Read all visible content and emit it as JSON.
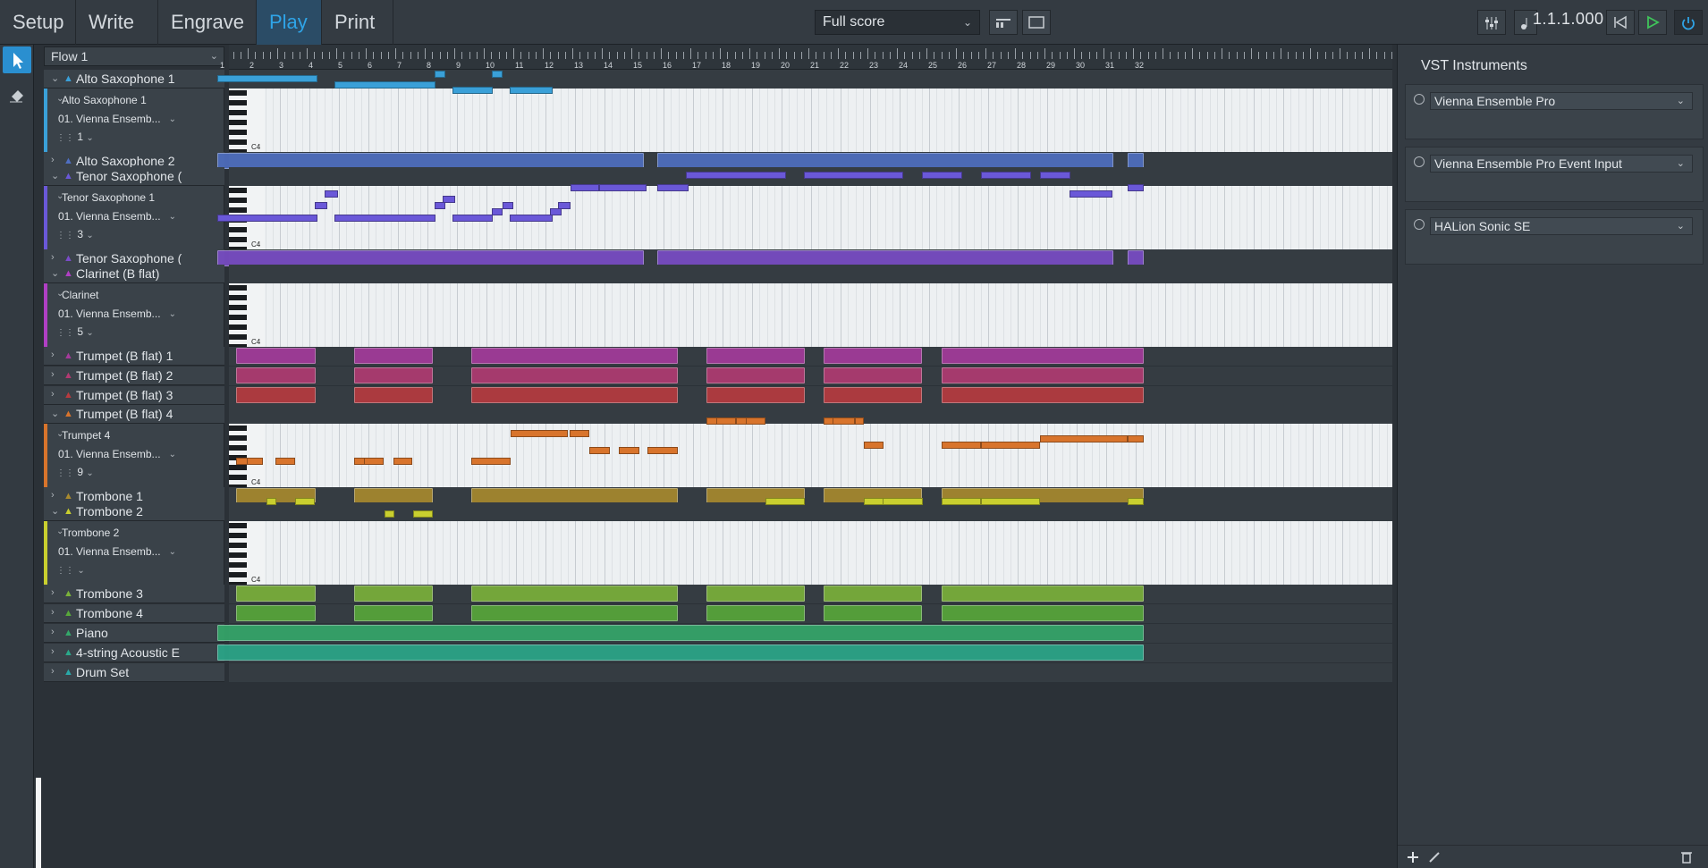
{
  "modes": [
    "Setup",
    "Write",
    "Engrave",
    "Play",
    "Print"
  ],
  "active_mode": "Play",
  "score_select": {
    "value": "Full score"
  },
  "position_readout": "1.1.1.000",
  "flow_select": {
    "value": "Flow 1"
  },
  "ruler_bars": [
    "1",
    "2",
    "3",
    "4",
    "5",
    "6",
    "7",
    "8",
    "9",
    "10",
    "11",
    "12",
    "13",
    "14",
    "15",
    "16",
    "17",
    "18",
    "19",
    "20",
    "21",
    "22",
    "23",
    "24",
    "25",
    "26",
    "27",
    "28",
    "29",
    "30",
    "31",
    "32"
  ],
  "pitch_label": "C4",
  "tracks": [
    {
      "name": "Alto Saxophone 1",
      "color": "#3aa0d8",
      "expanded": true,
      "sub": "Alto Saxophone 1",
      "port": "01. Vienna Ensemb...",
      "channel": "1"
    },
    {
      "name": "Alto Saxophone 2",
      "color": "#4f6fc2",
      "expanded": false
    },
    {
      "name": "Tenor Saxophone (",
      "color": "#6a58d8",
      "expanded": true,
      "sub": "Tenor Saxophone 1",
      "port": "01. Vienna Ensemb...",
      "channel": "3"
    },
    {
      "name": "Tenor Saxophone (",
      "color": "#7a4cc8",
      "expanded": false
    },
    {
      "name": "Clarinet (B flat)",
      "color": "#b03fc4",
      "expanded": true,
      "sub": "Clarinet",
      "port": "01. Vienna Ensemb...",
      "channel": "5"
    },
    {
      "name": "Trumpet (B flat) 1",
      "color": "#a53a9c",
      "expanded": false
    },
    {
      "name": "Trumpet (B flat) 2",
      "color": "#b23a72",
      "expanded": false
    },
    {
      "name": "Trumpet (B flat) 3",
      "color": "#b83a3f",
      "expanded": false
    },
    {
      "name": "Trumpet (B flat) 4",
      "color": "#d8742c",
      "expanded": true,
      "sub": "Trumpet 4",
      "port": "01. Vienna Ensemb...",
      "channel": "9"
    },
    {
      "name": "Trombone 1",
      "color": "#a98a2e",
      "expanded": false
    },
    {
      "name": "Trombone 2",
      "color": "#c9cf2f",
      "expanded": true,
      "sub": "Trombone 2",
      "port": "01. Vienna Ensemb...",
      "channel": ""
    },
    {
      "name": "Trombone 3",
      "color": "#7bb23a",
      "expanded": false
    },
    {
      "name": "Trombone 4",
      "color": "#58a83a",
      "expanded": false
    },
    {
      "name": "Piano",
      "color": "#34a86a",
      "expanded": false
    },
    {
      "name": "4-string Acoustic E",
      "color": "#2aa88a",
      "expanded": false
    },
    {
      "name": "Drum Set",
      "color": "#2aa8a8",
      "expanded": false
    }
  ],
  "right_panel": {
    "title": "VST Instruments",
    "instruments": [
      "Vienna Ensemble Pro",
      "Vienna Ensemble Pro Event Input",
      "HALion Sonic SE"
    ]
  },
  "colors": {
    "accent": "#2fa4e7",
    "play_green": "#3fc45a"
  }
}
